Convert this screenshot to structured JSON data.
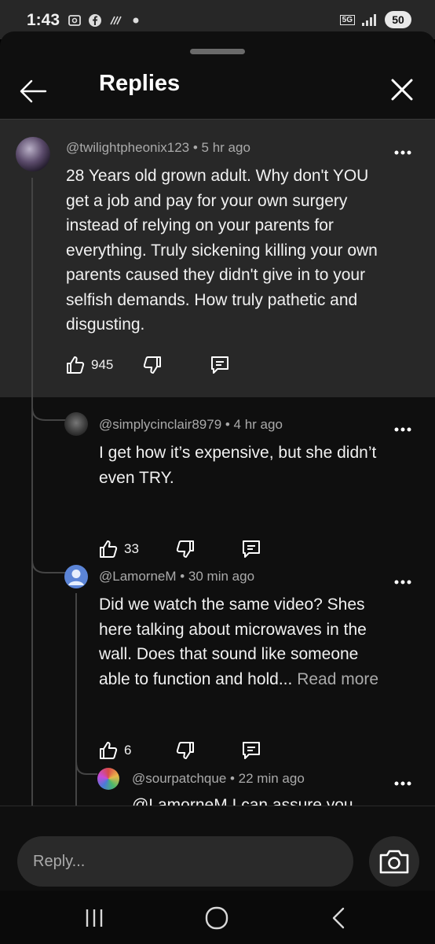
{
  "status_bar": {
    "time": "1:43",
    "icons": [
      "screenshot-icon",
      "facebook-icon",
      "hotspot-icon",
      "dot-icon"
    ],
    "network": "5G",
    "battery": "50"
  },
  "header": {
    "title": "Replies"
  },
  "comments": [
    {
      "handle": "@twilightpheonix123 • 5 hr ago",
      "lines": [
        "28 Years old grown adult. Why don't YOU",
        "get a job and pay for your own surgery",
        "instead of relying on your parents for",
        "everything. Truly sickening killing your own",
        "parents caused they didn't give in to your",
        "selfish demands. How truly pathetic and",
        "disgusting."
      ],
      "likes": "945"
    },
    {
      "handle": "@simplycinclair8979 • 4 hr ago",
      "lines": [
        "I get how it’s expensive, but she didn’t",
        "even TRY."
      ],
      "likes": "33"
    },
    {
      "handle": "@LamorneM • 30 min ago",
      "lines": [
        "Did we watch the same video? Shes",
        "here talking about microwaves in the",
        "wall. Does that sound like someone",
        "able to function and hold..."
      ],
      "read_more": "Read more",
      "likes": "6"
    },
    {
      "handle": "@sourpatchque • 22 min ago",
      "lines": [
        "@LamorneM I can assure you"
      ]
    }
  ],
  "composer": {
    "placeholder": "Reply..."
  },
  "colors": {
    "background": "#0f0f0f",
    "highlight_card": "#282828",
    "text": "#f1f1f1",
    "muted": "#aaaaaa"
  }
}
